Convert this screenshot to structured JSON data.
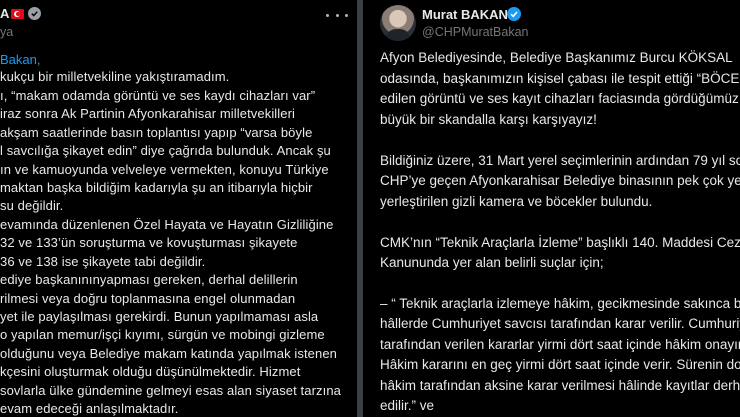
{
  "left_post": {
    "author_partial": "A",
    "handle_partial": "ya",
    "mention_partial": "Bakan,",
    "lines": [
      "kukçu bir milletvekiline yakıştıramadım.",
      "ı, “makam odamda görüntü ve ses kaydı cihazları var”",
      "iraz sonra Ak Partinin Afyonkarahisar milletvekilleri",
      " akşam saatlerinde basın toplantısı yapıp “varsa böyle",
      "l savcılığa şikayet edin” diye çağrıda bulunduk. Ancak şu",
      "ın ve kamuoyunda velveleye vermekten, konuyu Türkiye",
      "maktan başka bildiğim kadarıyla şu an itibarıyla hiçbir",
      "su değildir.",
      "evamında düzenlenen Özel Hayata ve Hayatın Gizliliğine",
      "32 ve 133’ün soruşturma ve kovuşturması şikayete",
      "36 ve 138 ise şikayete tabi değildir.",
      "ediye başkanınınyapması gereken, derhal delillerin",
      "rilmesi veya doğru toplanmasına engel olunmadan",
      "yet ile paylaşılması gerekirdi. Bunun yapılmaması asla",
      "o yapılan memur/işçi kıyımı, sürgün ve mobingi gizleme",
      "olduğunu veya Belediye makam katında yapılmak istenen",
      "kçesini oluşturmak olduğu düşünülmektedir. Hizmet",
      "sovlarla ülke gündemine gelmeyi esas alan siyaset tarzına",
      "evam edeceği anlaşılmaktadır."
    ]
  },
  "right_post": {
    "author": "Murat BAKAN",
    "handle": "@CHPMuratBakan",
    "lines": [
      "Afyon Belediyesinde, Belediye Başkanımız Burcu KÖKSAL",
      "odasında, başkanımızın kişisel çabası ile tespit ettiği “BÖCEK",
      "edilen görüntü ve ses kayıt cihazları faciasında gördüğümüz",
      "büyük bir skandalla karşı karşıyayız!",
      "",
      "Bildiğiniz üzere, 31 Mart yerel seçimlerinin ardından 79 yıl sonra",
      "CHP’ye geçen Afyonkarahisar Belediye binasının pek çok yerine",
      "yerleştirilen gizli kamera ve böcekler bulundu.",
      "",
      "CMK’nın “Teknik Araçlarla İzleme” başlıklı  140. Maddesi Ceza",
      "Kanununda yer alan belirli suçlar için;",
      "",
      "–  “ Teknik araçlarla izlemeye hâkim, gecikmesinde sakınca bulunan",
      "hâllerde Cumhuriyet savcısı tarafından karar verilir. Cumhuriyet savcısı",
      "tarafından verilen kararlar yirmi dört saat içinde hâkim onayına sunulur.",
      "Hâkim kararını en geç yirmi dört saat içinde verir. Sürenin dolması veya",
      "hâkim tarafından aksine karar verilmesi hâlinde kayıtlar derhâl yok",
      "edilir.” ve"
    ]
  }
}
